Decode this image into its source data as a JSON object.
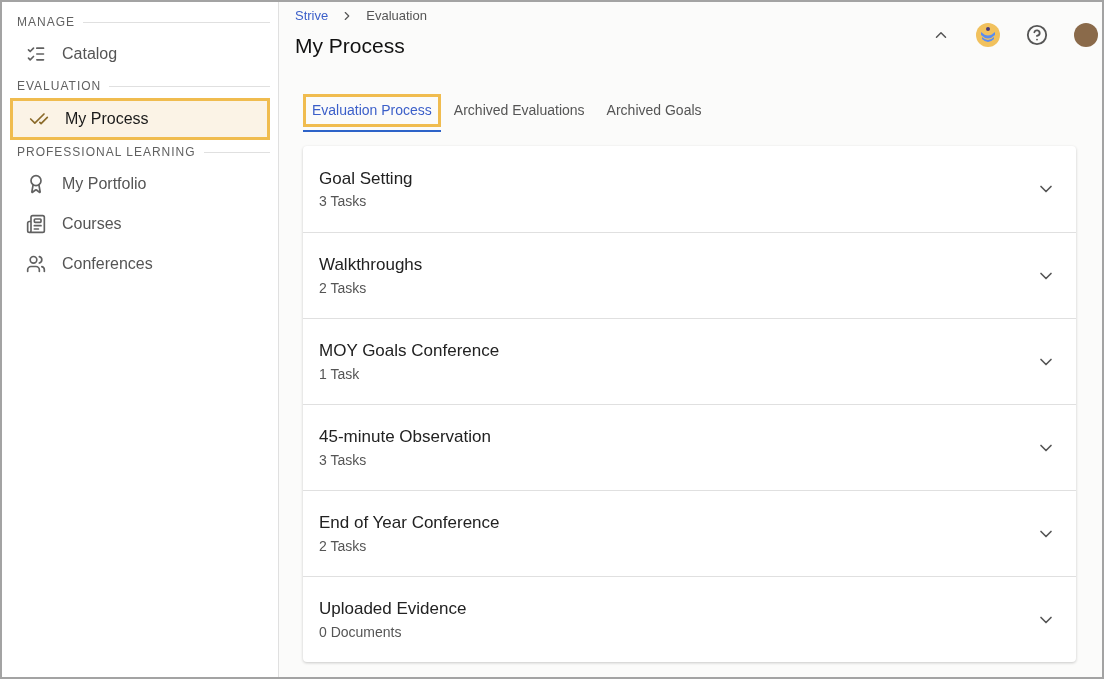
{
  "sidebar": {
    "sections": [
      {
        "heading": "MANAGE",
        "items": [
          {
            "label": "Catalog",
            "selected": false
          }
        ]
      },
      {
        "heading": "EVALUATION",
        "items": [
          {
            "label": "My Process",
            "selected": true
          }
        ]
      },
      {
        "heading": "PROFESSIONAL LEARNING",
        "items": [
          {
            "label": "My Portfolio",
            "selected": false
          },
          {
            "label": "Courses",
            "selected": false
          },
          {
            "label": "Conferences",
            "selected": false
          }
        ]
      }
    ]
  },
  "breadcrumb": [
    "Strive",
    "Evaluation"
  ],
  "page_title": "My Process",
  "tabs": [
    {
      "label": "Evaluation Process",
      "selected": true
    },
    {
      "label": "Archived Evaluations",
      "selected": false
    },
    {
      "label": "Archived Goals",
      "selected": false
    }
  ],
  "panels": [
    {
      "title": "Goal Setting",
      "subtitle": "3 Tasks",
      "expanded": false
    },
    {
      "title": "Walkthroughs",
      "subtitle": "2 Tasks",
      "expanded": false
    },
    {
      "title": "MOY Goals Conference",
      "subtitle": "1 Task",
      "expanded": false
    },
    {
      "title": "45-minute Observation",
      "subtitle": "3 Tasks",
      "expanded": false
    },
    {
      "title": "End of Year Conference",
      "subtitle": "2 Tasks",
      "expanded": false
    },
    {
      "title": "Uploaded Evidence",
      "subtitle": "0 Documents",
      "expanded": false
    }
  ]
}
